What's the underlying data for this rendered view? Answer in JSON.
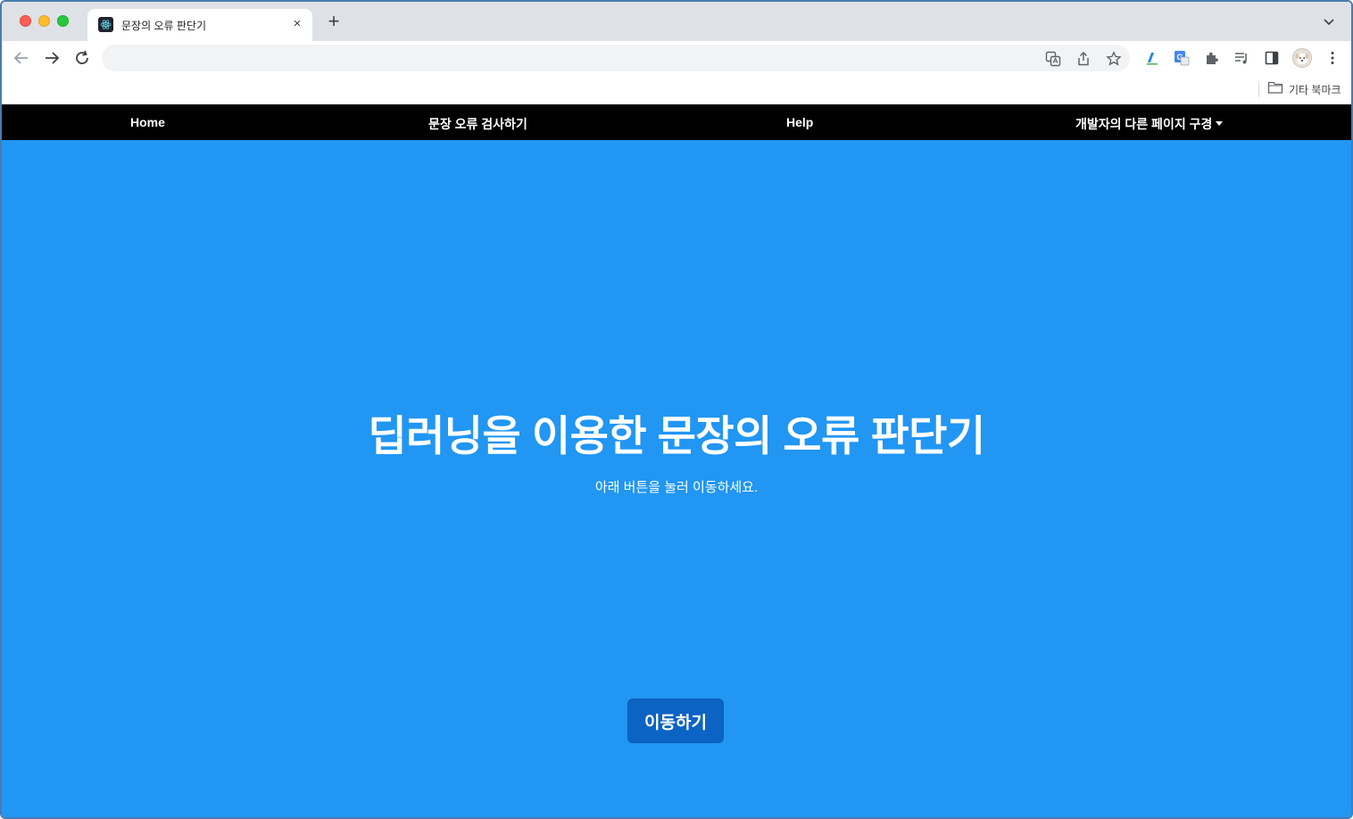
{
  "browser": {
    "tab_title": "문장의 오류 판단기",
    "new_tab_symbol": "+",
    "close_symbol": "×",
    "address": "",
    "bookmark_folder": "기타 북마크",
    "icons": [
      "back-icon",
      "forward-icon",
      "reload-icon",
      "translate-icon",
      "share-icon",
      "star-icon",
      "extension-papago-icon",
      "extension-google-translate-icon",
      "puzzle-icon",
      "media-icon",
      "side-panel-icon",
      "avatar",
      "more-icon"
    ]
  },
  "navbar": {
    "items": [
      {
        "label": "Home"
      },
      {
        "label": "문장 오류 검사하기"
      },
      {
        "label": "Help"
      },
      {
        "label": "개발자의 다른 페이지 구경"
      }
    ]
  },
  "hero": {
    "title": "딥러닝을 이용한 문장의 오류 판단기",
    "subtitle": "아래 버튼을 눌러 이동하세요.",
    "button_label": "이동하기"
  },
  "colors": {
    "page_background": "#2196f3",
    "navbar_background": "#000000",
    "button_background": "#0b63c4"
  }
}
